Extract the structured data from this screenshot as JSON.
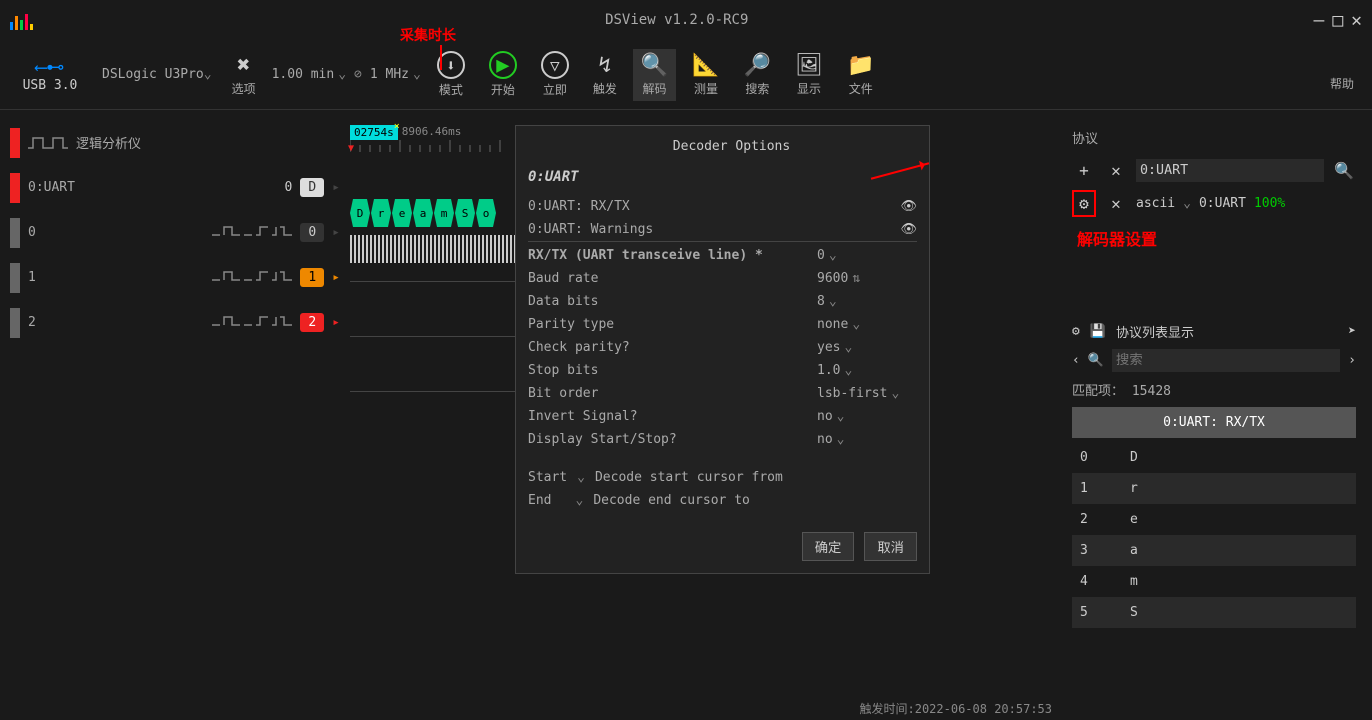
{
  "annotations": {
    "capture_duration": "采集时长",
    "decoder_settings": "解码器设置"
  },
  "titlebar": {
    "title": "DSView v1.2.0-RC9"
  },
  "toolbar": {
    "usb_label": "USB 3.0",
    "device": "DSLogic U3Pro",
    "duration_value": "1.00 min",
    "frequency": "1 MHz",
    "btn_options": "选项",
    "btn_mode": "模式",
    "btn_start": "开始",
    "btn_instant": "立即",
    "btn_trigger": "触发",
    "btn_decode": "解码",
    "btn_measure": "测量",
    "btn_search": "搜索",
    "btn_display": "显示",
    "btn_file": "文件",
    "btn_help": "帮助"
  },
  "channels": {
    "header": "逻辑分析仪",
    "ch0": "0:UART",
    "ch0_val": "0",
    "ch1": "0",
    "ch1_num": "0",
    "ch2": "1",
    "ch2_num": "1",
    "ch3": "2",
    "ch3_num": "2"
  },
  "waveform": {
    "cursor_time": "02754s",
    "ruler_time": "8906.46ms",
    "decoded_chars": [
      "D",
      "r",
      "e",
      "a",
      "m",
      "S",
      "o"
    ]
  },
  "decoder": {
    "title": "Decoder Options",
    "section": "0:UART",
    "row_rxtx": "0:UART: RX/TX",
    "row_warnings": "0:UART: Warnings",
    "opt_rxtx_label": "RX/TX (UART transceive line) *",
    "opt_rxtx_value": "0",
    "opt_baud_label": "Baud rate",
    "opt_baud_value": "9600",
    "opt_databits_label": "Data bits",
    "opt_databits_value": "8",
    "opt_parity_label": "Parity type",
    "opt_parity_value": "none",
    "opt_check_label": "Check parity?",
    "opt_check_value": "yes",
    "opt_stop_label": "Stop bits",
    "opt_stop_value": "1.0",
    "opt_bitorder_label": "Bit order",
    "opt_bitorder_value": "lsb-first",
    "opt_invert_label": "Invert Signal?",
    "opt_invert_value": "no",
    "opt_display_label": "Display Start/Stop?",
    "opt_display_value": "no",
    "cursor_start": "Start",
    "cursor_start_desc": "Decode start cursor from",
    "cursor_end": "End",
    "cursor_end_desc": "Decode end cursor to",
    "btn_ok": "确定",
    "btn_cancel": "取消"
  },
  "protocol": {
    "title": "协议",
    "search_value": "0:UART",
    "format": "ascii",
    "decoder_name": "0:UART",
    "percent": "100%"
  },
  "results": {
    "list_display": "协议列表显示",
    "search_placeholder": "搜索",
    "match_label": "匹配项：",
    "match_count": "15428",
    "header": "0:UART: RX/TX",
    "items": [
      {
        "idx": "0",
        "val": "D"
      },
      {
        "idx": "1",
        "val": "r"
      },
      {
        "idx": "2",
        "val": "e"
      },
      {
        "idx": "3",
        "val": "a"
      },
      {
        "idx": "4",
        "val": "m"
      },
      {
        "idx": "5",
        "val": "S"
      }
    ]
  },
  "statusbar": {
    "trigger_time": "触发时间:2022-06-08 20:57:53"
  }
}
